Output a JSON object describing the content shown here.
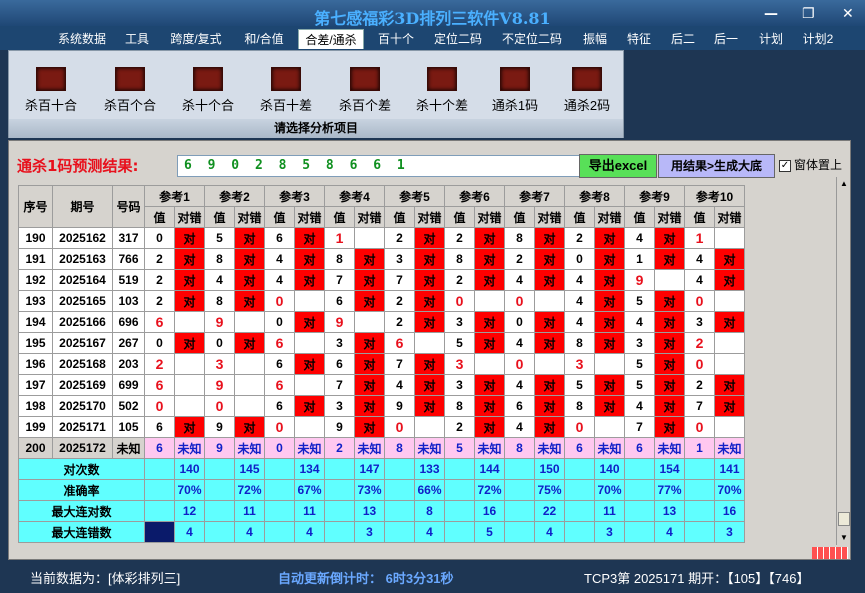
{
  "title": "第七感福彩3D排列三软件V8.81",
  "menu": [
    "系统数据",
    "工具",
    "跨度/复式",
    "和/合值",
    "合差/通杀",
    "百十个",
    "定位二码",
    "不定位二码",
    "振幅",
    "特征",
    "后二",
    "后一",
    "计划",
    "计划2"
  ],
  "menu_active": "合差/通杀",
  "ribbon": {
    "buttons": [
      "杀百十合",
      "杀百个合",
      "杀十个合",
      "杀百十差",
      "杀百个差",
      "杀十个差",
      "通杀1码",
      "通杀2码"
    ],
    "caption": "请选择分析项目"
  },
  "prediction": {
    "label": "通杀1码预测结果:",
    "value": "6 9 0 2 8 5 8 6 6 1",
    "excel_button": "导出excel",
    "generate_button": "用结果>生成大底",
    "topmost_label": "窗体置上",
    "topmost_checked": "✓"
  },
  "table": {
    "head_seq": "序号",
    "head_period": "期号",
    "head_number": "号码",
    "refs": [
      "参考1",
      "参考2",
      "参考3",
      "参考4",
      "参考5",
      "参考6",
      "参考7",
      "参考8",
      "参考9",
      "参考10"
    ],
    "sub_value": "值",
    "sub_result": "对错",
    "rows": [
      {
        "seq": "190",
        "period": "2025162",
        "number": "317",
        "cells": [
          [
            "0",
            "对"
          ],
          [
            "5",
            "对"
          ],
          [
            "6",
            "对"
          ],
          [
            "1",
            ""
          ],
          [
            "2",
            "对"
          ],
          [
            "2",
            "对"
          ],
          [
            "8",
            "对"
          ],
          [
            "2",
            "对"
          ],
          [
            "4",
            "对"
          ],
          [
            "1",
            ""
          ]
        ]
      },
      {
        "seq": "191",
        "period": "2025163",
        "number": "766",
        "cells": [
          [
            "2",
            "对"
          ],
          [
            "8",
            "对"
          ],
          [
            "4",
            "对"
          ],
          [
            "8",
            "对"
          ],
          [
            "3",
            "对"
          ],
          [
            "8",
            "对"
          ],
          [
            "2",
            "对"
          ],
          [
            "0",
            "对"
          ],
          [
            "1",
            "对"
          ],
          [
            "4",
            "对"
          ]
        ]
      },
      {
        "seq": "192",
        "period": "2025164",
        "number": "519",
        "cells": [
          [
            "2",
            "对"
          ],
          [
            "4",
            "对"
          ],
          [
            "4",
            "对"
          ],
          [
            "7",
            "对"
          ],
          [
            "7",
            "对"
          ],
          [
            "2",
            "对"
          ],
          [
            "4",
            "对"
          ],
          [
            "4",
            "对"
          ],
          [
            "9",
            ""
          ],
          [
            "4",
            "对"
          ]
        ]
      },
      {
        "seq": "193",
        "period": "2025165",
        "number": "103",
        "cells": [
          [
            "2",
            "对"
          ],
          [
            "8",
            "对"
          ],
          [
            "0",
            ""
          ],
          [
            "6",
            "对"
          ],
          [
            "2",
            "对"
          ],
          [
            "0",
            ""
          ],
          [
            "0",
            ""
          ],
          [
            "4",
            "对"
          ],
          [
            "5",
            "对"
          ],
          [
            "0",
            ""
          ]
        ]
      },
      {
        "seq": "194",
        "period": "2025166",
        "number": "696",
        "cells": [
          [
            "6",
            ""
          ],
          [
            "9",
            ""
          ],
          [
            "0",
            "对"
          ],
          [
            "9",
            ""
          ],
          [
            "2",
            "对"
          ],
          [
            "3",
            "对"
          ],
          [
            "0",
            "对"
          ],
          [
            "4",
            "对"
          ],
          [
            "4",
            "对"
          ],
          [
            "3",
            "对"
          ]
        ]
      },
      {
        "seq": "195",
        "period": "2025167",
        "number": "267",
        "cells": [
          [
            "0",
            "对"
          ],
          [
            "0",
            "对"
          ],
          [
            "6",
            ""
          ],
          [
            "3",
            "对"
          ],
          [
            "6",
            ""
          ],
          [
            "5",
            "对"
          ],
          [
            "4",
            "对"
          ],
          [
            "8",
            "对"
          ],
          [
            "3",
            "对"
          ],
          [
            "2",
            ""
          ]
        ]
      },
      {
        "seq": "196",
        "period": "2025168",
        "number": "203",
        "cells": [
          [
            "2",
            ""
          ],
          [
            "3",
            ""
          ],
          [
            "6",
            "对"
          ],
          [
            "6",
            "对"
          ],
          [
            "7",
            "对"
          ],
          [
            "3",
            ""
          ],
          [
            "0",
            ""
          ],
          [
            "3",
            ""
          ],
          [
            "5",
            "对"
          ],
          [
            "0",
            ""
          ]
        ]
      },
      {
        "seq": "197",
        "period": "2025169",
        "number": "699",
        "cells": [
          [
            "6",
            ""
          ],
          [
            "9",
            ""
          ],
          [
            "6",
            ""
          ],
          [
            "7",
            "对"
          ],
          [
            "4",
            "对"
          ],
          [
            "3",
            "对"
          ],
          [
            "4",
            "对"
          ],
          [
            "5",
            "对"
          ],
          [
            "5",
            "对"
          ],
          [
            "2",
            "对"
          ]
        ]
      },
      {
        "seq": "198",
        "period": "2025170",
        "number": "502",
        "cells": [
          [
            "0",
            ""
          ],
          [
            "0",
            ""
          ],
          [
            "6",
            "对"
          ],
          [
            "3",
            "对"
          ],
          [
            "9",
            "对"
          ],
          [
            "8",
            "对"
          ],
          [
            "6",
            "对"
          ],
          [
            "8",
            "对"
          ],
          [
            "4",
            "对"
          ],
          [
            "7",
            "对"
          ]
        ]
      },
      {
        "seq": "199",
        "period": "2025171",
        "number": "105",
        "cells": [
          [
            "6",
            "对"
          ],
          [
            "9",
            "对"
          ],
          [
            "0",
            ""
          ],
          [
            "9",
            "对"
          ],
          [
            "0",
            ""
          ],
          [
            "2",
            "对"
          ],
          [
            "4",
            "对"
          ],
          [
            "0",
            ""
          ],
          [
            "7",
            "对"
          ],
          [
            "0",
            ""
          ]
        ]
      }
    ],
    "pending_row": {
      "seq": "200",
      "period": "2025172",
      "number": "未知",
      "values": [
        "6",
        "9",
        "0",
        "2",
        "8",
        "5",
        "8",
        "6",
        "6",
        "1"
      ],
      "result": "未知"
    },
    "stats": [
      {
        "label": "对次数",
        "values": [
          "140",
          "145",
          "134",
          "147",
          "133",
          "144",
          "150",
          "140",
          "154",
          "141"
        ]
      },
      {
        "label": "准确率",
        "values": [
          "70%",
          "72%",
          "67%",
          "73%",
          "66%",
          "72%",
          "75%",
          "70%",
          "77%",
          "70%"
        ]
      },
      {
        "label": "最大连对数",
        "values": [
          "12",
          "11",
          "11",
          "13",
          "8",
          "16",
          "22",
          "11",
          "13",
          "16"
        ]
      },
      {
        "label": "最大连错数",
        "values": [
          "4",
          "4",
          "4",
          "3",
          "4",
          "5",
          "4",
          "3",
          "4",
          "3"
        ]
      }
    ]
  },
  "status": {
    "current_data": "当前数据为：[体彩排列三]",
    "countdown": "自动更新倒计时：  6时3分31秒",
    "latest": "TCP3第 2025171 期开：【105】【746】"
  },
  "colors": {
    "hit": "#ff0000",
    "pending": "#ffc8f0",
    "stats": "#60ffff",
    "accent_red": "#e8101c",
    "predict_green": "#109020"
  }
}
